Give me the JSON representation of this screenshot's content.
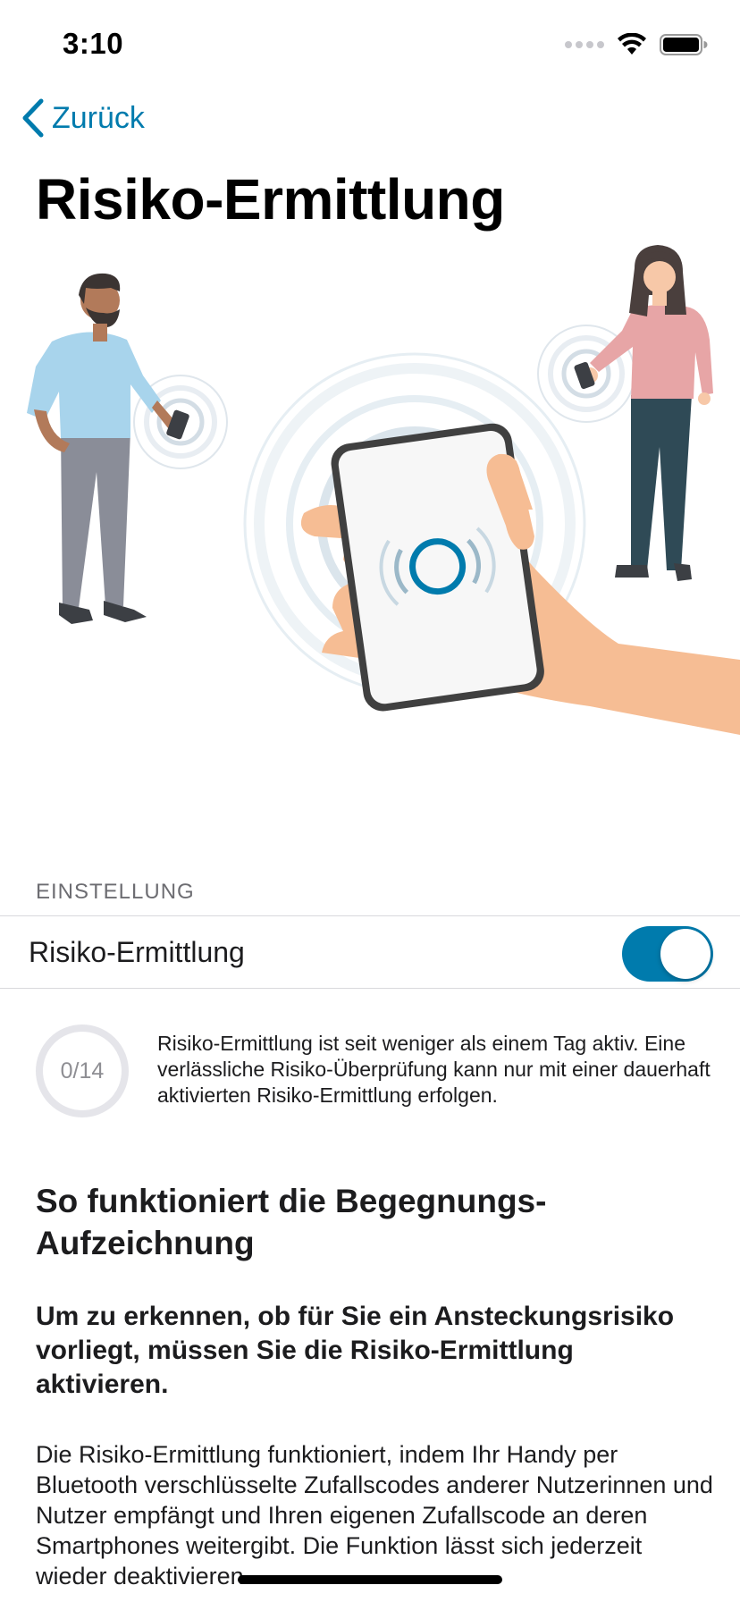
{
  "status_bar": {
    "time": "3:10"
  },
  "nav": {
    "back_label": "Zurück"
  },
  "page": {
    "title": "Risiko-Ermittlung"
  },
  "settings": {
    "section_header": "EINSTELLUNG",
    "toggle_label": "Risiko-Ermittlung",
    "toggle_on": true
  },
  "progress": {
    "value_text": "0/14",
    "description": "Risiko-Ermittlung ist seit weniger als einem Tag aktiv. Eine verlässliche Risiko-Überprüfung kann nur mit einer dauerhaft aktivierten Risiko-Ermittlung erfolgen."
  },
  "info": {
    "title": "So funktioniert die Begegnungs-Aufzeichnung",
    "subtitle": "Um zu erkennen, ob für Sie ein Ansteckungsrisiko vorliegt, müssen Sie die Risiko-Ermittlung aktivieren.",
    "body": "Die Risiko-Ermittlung funktioniert, indem Ihr Handy per Bluetooth verschlüsselte Zufallscodes anderer Nutzerinnen und Nutzer empfängt und Ihren eigenen Zufallscode an deren Smartphones weitergibt. Die Funktion lässt sich jederzeit wieder deaktivieren."
  },
  "colors": {
    "accent": "#007bad",
    "toggle_on": "#007bad",
    "ring_track": "#e5e5ea"
  }
}
